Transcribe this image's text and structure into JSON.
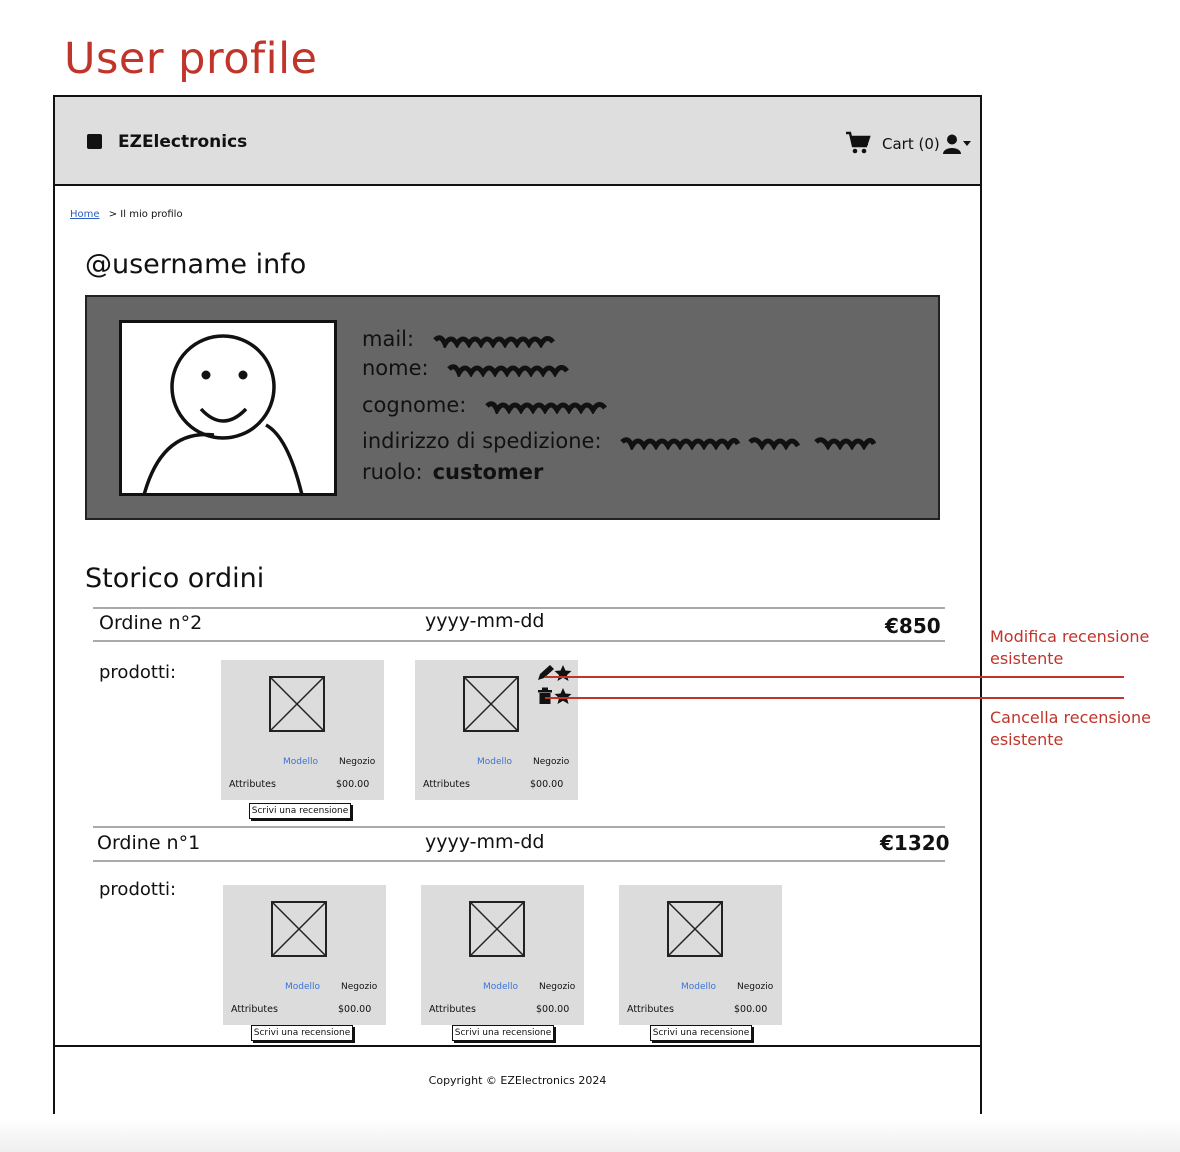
{
  "page_title": "User profile",
  "navbar": {
    "brand": "EZElectronics",
    "cart_label": "Cart (0)"
  },
  "breadcrumb": {
    "home": "Home",
    "separator": ">",
    "current": "Il mio profilo"
  },
  "profile": {
    "heading": "@username info",
    "fields": [
      {
        "label": "mail:"
      },
      {
        "label": "nome:"
      },
      {
        "label": "cognome:"
      },
      {
        "label": "indirizzo di spedizione:"
      },
      {
        "label": "ruolo:",
        "value": "customer"
      }
    ]
  },
  "orders_section": {
    "heading": "Storico ordini",
    "products_label": "prodotti:",
    "orders": [
      {
        "title": "Ordine n°2",
        "date": "yyyy-mm-dd",
        "total": "€850",
        "products": [
          {
            "model": "Modello",
            "store": "Negozio",
            "attributes": "Attributes",
            "price": "$00.00",
            "action": "Scrivi una recensione"
          },
          {
            "model": "Modello",
            "store": "Negozio",
            "attributes": "Attributes",
            "price": "$00.00",
            "has_review": true
          }
        ]
      },
      {
        "title": "Ordine n°1",
        "date": "yyyy-mm-dd",
        "total": "€1320",
        "products": [
          {
            "model": "Modello",
            "store": "Negozio",
            "attributes": "Attributes",
            "price": "$00.00",
            "action": "Scrivi una recensione"
          },
          {
            "model": "Modello",
            "store": "Negozio",
            "attributes": "Attributes",
            "price": "$00.00",
            "action": "Scrivi una recensione"
          },
          {
            "model": "Modello",
            "store": "Negozio",
            "attributes": "Attributes",
            "price": "$00.00",
            "action": "Scrivi una recensione"
          }
        ]
      }
    ]
  },
  "footer": {
    "copyright": "Copyright © EZElectronics 2024"
  },
  "annotations": {
    "edit_review": "Modifica recensione esistente",
    "delete_review": "Cancella recensione esistente"
  },
  "colors": {
    "annotation": "#c0342a",
    "link": "#2b5fc4",
    "navbar_bg": "#dedede",
    "info_box_bg": "#666666",
    "card_bg": "#dcdcdc"
  }
}
